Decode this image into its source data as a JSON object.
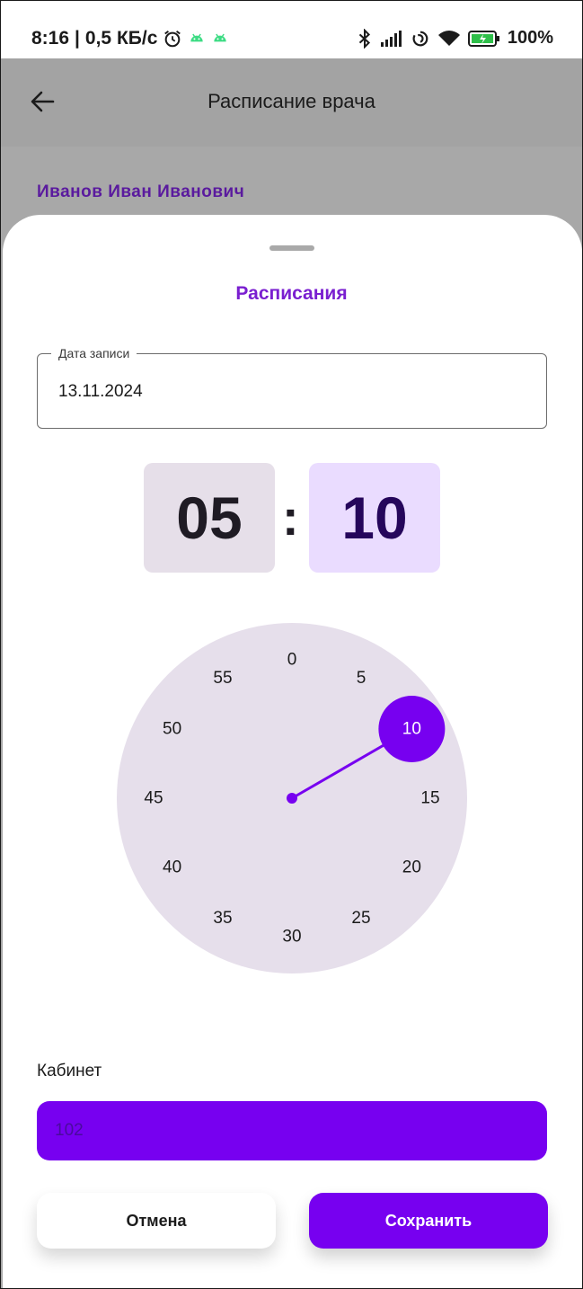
{
  "status_bar": {
    "time": "8:16",
    "speed": "0,5 КБ/с",
    "battery": "100%",
    "icons": [
      "alarm-icon",
      "android-icon",
      "bluetooth-icon",
      "signal-icon",
      "sync-icon",
      "wifi-icon",
      "battery-icon"
    ]
  },
  "app_bar": {
    "title": "Расписание врача",
    "back_icon": "arrow-back-icon"
  },
  "doctor_name": "Иванов Иван Иванович",
  "sheet": {
    "title": "Расписания",
    "date_field": {
      "label": "Дата записи",
      "value": "13.11.2024"
    },
    "time_picker": {
      "hours": "05",
      "separator": ":",
      "minutes": "10",
      "dial_labels": [
        "0",
        "5",
        "10",
        "15",
        "20",
        "25",
        "30",
        "35",
        "40",
        "45",
        "50",
        "55"
      ],
      "selected_minute": 10
    },
    "cabinet": {
      "label": "Кабинет",
      "value": "102"
    },
    "buttons": {
      "cancel": "Отмена",
      "save": "Сохранить"
    }
  },
  "colors": {
    "accent": "#7700F0",
    "accent_title": "#7A1FD0",
    "doctor": "#5A1A9E",
    "dial_bg": "#E6DFEB",
    "scrim": "#A8A8A8"
  }
}
